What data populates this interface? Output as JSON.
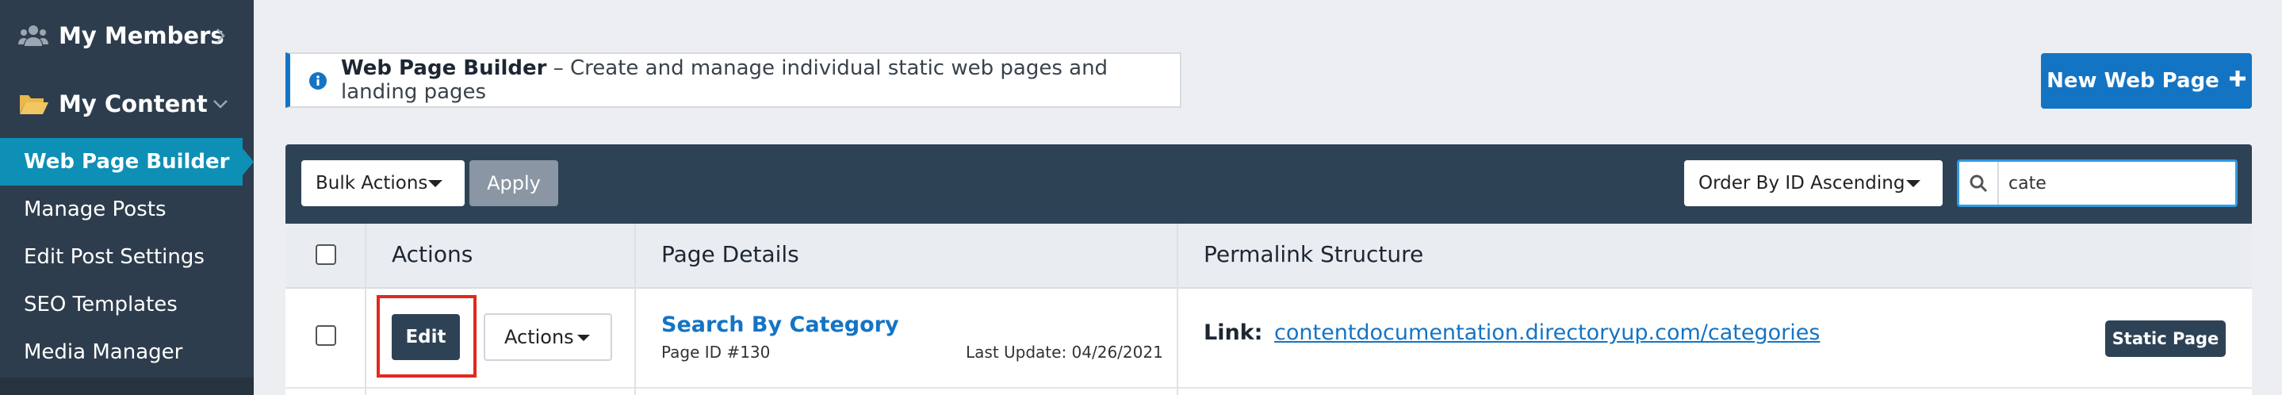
{
  "sidebar": {
    "members": {
      "label": "My Members",
      "icon": "users-icon"
    },
    "content": {
      "label": "My Content",
      "icon": "folder-open-icon"
    },
    "items": [
      {
        "label": "Web Page Builder",
        "active": true
      },
      {
        "label": "Manage Posts"
      },
      {
        "label": "Edit Post Settings"
      },
      {
        "label": "SEO Templates"
      },
      {
        "label": "Media Manager"
      }
    ]
  },
  "banner": {
    "title": "Web Page Builder",
    "description": " – Create and manage individual static web pages and landing pages",
    "icon": "info-icon"
  },
  "new_page_button": {
    "label": "New Web Page",
    "icon": "plus-icon"
  },
  "toolbar": {
    "bulk_actions": "Bulk Actions",
    "apply": "Apply",
    "order_by": "Order By ID Ascending",
    "search": {
      "value": "cate",
      "icon": "search-icon"
    }
  },
  "table": {
    "columns": [
      "Actions",
      "Page Details",
      "Permalink Structure"
    ],
    "rows": [
      {
        "edit": "Edit",
        "actions": "Actions",
        "title": "Search By Category",
        "page_id": "Page ID #130",
        "last_update": "Last Update: 04/26/2021",
        "link_label": "Link:",
        "link_url": "contentdocumentation.directoryup.com/categories",
        "badge": "Static Page"
      }
    ]
  },
  "colors": {
    "sidebar_bg": "#2e3d4d",
    "active_item": "#0e8fb5",
    "primary": "#1474c4",
    "toolbar_bg": "#2e4256",
    "highlight": "#e02a1c"
  }
}
